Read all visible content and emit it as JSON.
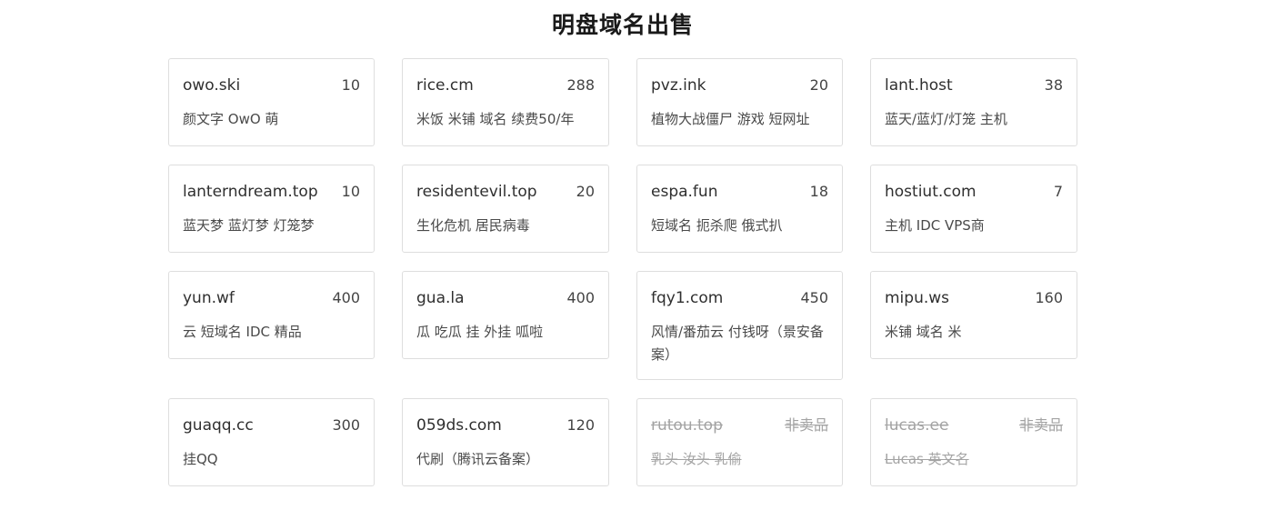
{
  "page": {
    "title": "明盘域名出售"
  },
  "domains": [
    {
      "domain": "owo.ski",
      "price": "10",
      "desc": "颜文字 OwO 萌"
    },
    {
      "domain": "rice.cm",
      "price": "288",
      "desc": "米饭 米铺 域名 续费50/年"
    },
    {
      "domain": "pvz.ink",
      "price": "20",
      "desc": "植物大战僵尸 游戏 短网址"
    },
    {
      "domain": "lant.host",
      "price": "38",
      "desc": "蓝天/蓝灯/灯笼 主机"
    },
    {
      "domain": "lanterndream.top",
      "price": "10",
      "desc": "蓝天梦 蓝灯梦 灯笼梦"
    },
    {
      "domain": "residentevil.top",
      "price": "20",
      "desc": "生化危机 居民病毒"
    },
    {
      "domain": "espa.fun",
      "price": "18",
      "desc": "短域名 扼杀爬 俄式扒"
    },
    {
      "domain": "hostiut.com",
      "price": "7",
      "desc": "主机 IDC VPS商"
    },
    {
      "domain": "yun.wf",
      "price": "400",
      "desc": "云 短域名 IDC 精品"
    },
    {
      "domain": "gua.la",
      "price": "400",
      "desc": "瓜 吃瓜 挂 外挂 呱啦"
    },
    {
      "domain": "fqy1.com",
      "price": "450",
      "desc": "风情/番茄云 付钱呀（景安备案）"
    },
    {
      "domain": "mipu.ws",
      "price": "160",
      "desc": "米铺 域名 米"
    },
    {
      "domain": "guaqq.cc",
      "price": "300",
      "desc": "挂QQ"
    },
    {
      "domain": "059ds.com",
      "price": "120",
      "desc": "代刷（腾讯云备案）"
    },
    {
      "domain": "rutou.top",
      "price": "非卖品",
      "desc": "乳头 汝头 乳偷"
    },
    {
      "domain": "lucas.ee",
      "price": "非卖品",
      "desc": "Lucas 英文名"
    }
  ]
}
